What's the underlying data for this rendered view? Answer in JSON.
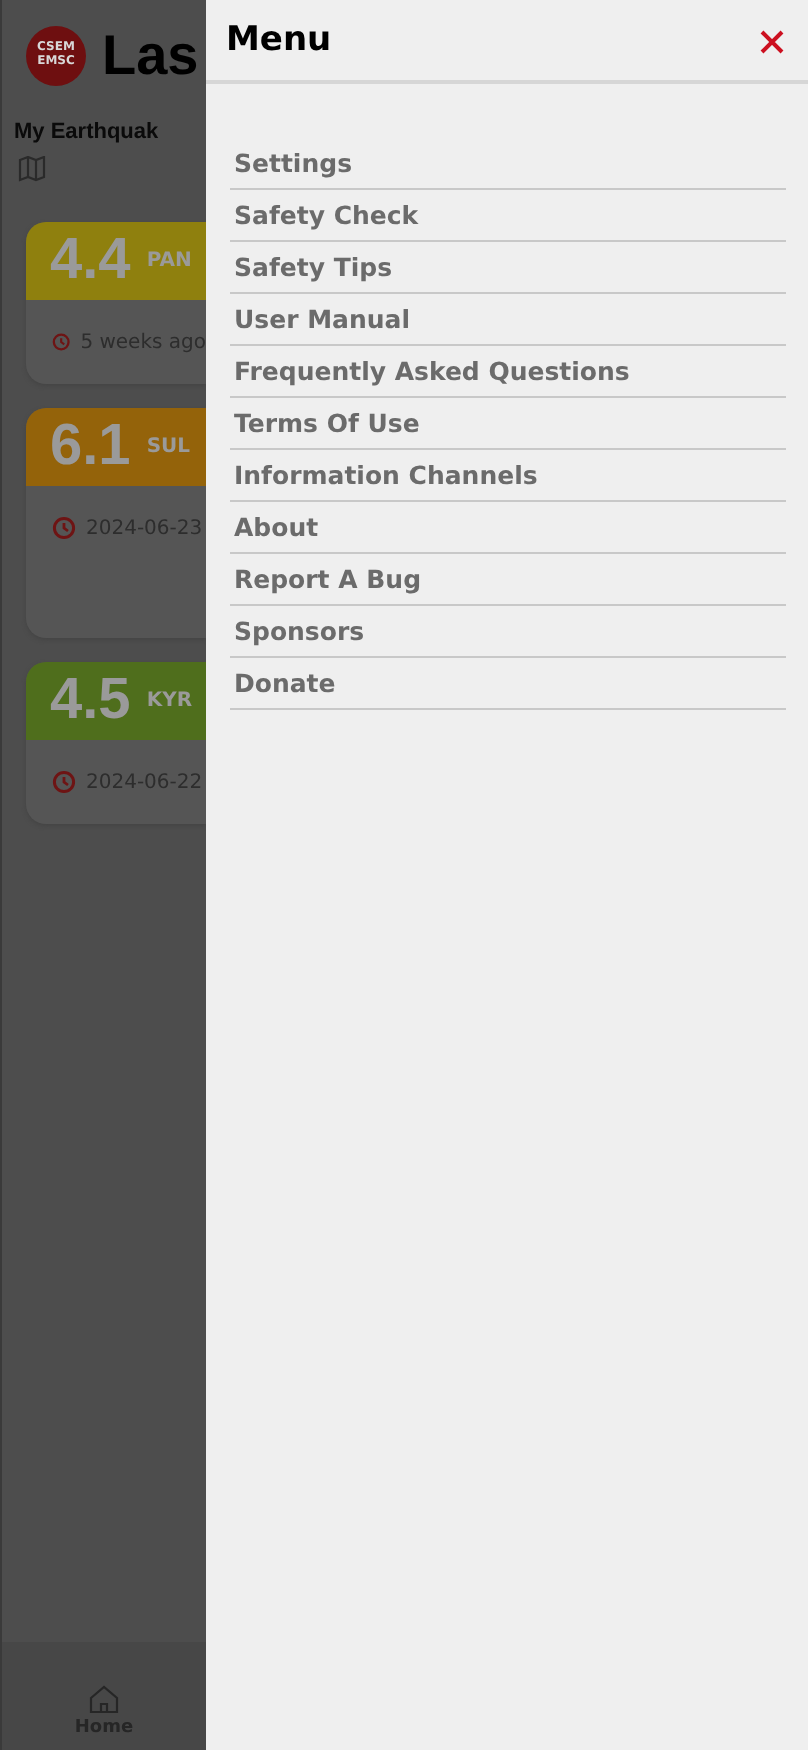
{
  "header": {
    "logo_top": "CSEM",
    "logo_bottom": "EMSC",
    "title": "Las"
  },
  "section": {
    "title": "My Earthquak"
  },
  "quakes": [
    {
      "magnitude": "4.4",
      "region": "PAN",
      "time": "5 weeks ago",
      "color": "#8f800e"
    },
    {
      "magnitude": "6.1",
      "region": "SUL",
      "time": "2024-06-23",
      "color": "#94630a",
      "tall": true
    },
    {
      "magnitude": "4.5",
      "region": "KYR",
      "time": "2024-06-22",
      "color": "#4f6e1c"
    }
  ],
  "bottom_nav": [
    {
      "label": "Home",
      "selected": true
    }
  ],
  "menu": {
    "title": "Menu",
    "items": [
      "Settings",
      "Safety Check",
      "Safety Tips",
      "User Manual",
      "Frequently Asked Questions",
      "Terms Of Use",
      "Information Channels",
      "About",
      "Report A Bug",
      "Sponsors",
      "Donate"
    ]
  }
}
